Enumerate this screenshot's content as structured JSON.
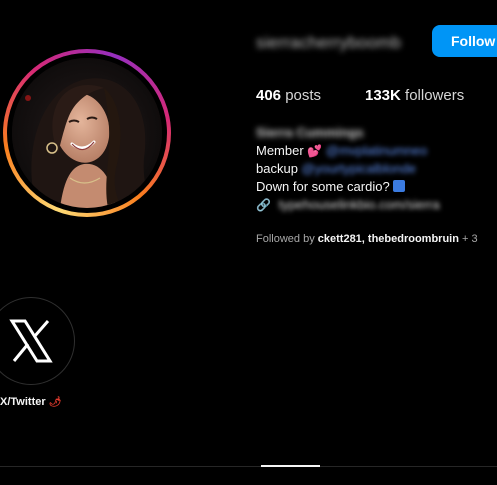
{
  "profile": {
    "username": "sierracherryboomb",
    "follow_label": "Follow",
    "stats": {
      "posts_count": "406",
      "posts_label": "posts",
      "followers_count": "133K",
      "followers_label": "followers"
    },
    "bio": {
      "full_name": "Sierra Cummings",
      "line1_text": "Member",
      "line1_link": "@mvplatinumneo",
      "line2_text": "backup",
      "line2_link": "@yourtypicalblonde",
      "line3_text": "Down for some cardio?",
      "link_text": "typehouselinkbio.com/sierra"
    },
    "followed_by": {
      "prefix": "Followed by",
      "names": "ckett281, thebedroombruin",
      "suffix": "+ 3"
    }
  },
  "highlights": [
    {
      "label": "X/Twitter"
    }
  ],
  "icons": {
    "avatar": "profile-photo",
    "highlight_cover": "x-logo-icon",
    "chain": "link-icon"
  },
  "colors": {
    "accent": "#0095f6",
    "background": "#000000",
    "text": "#f5f5f5",
    "muted": "#a8a8a8",
    "link": "#5f8ff0"
  }
}
